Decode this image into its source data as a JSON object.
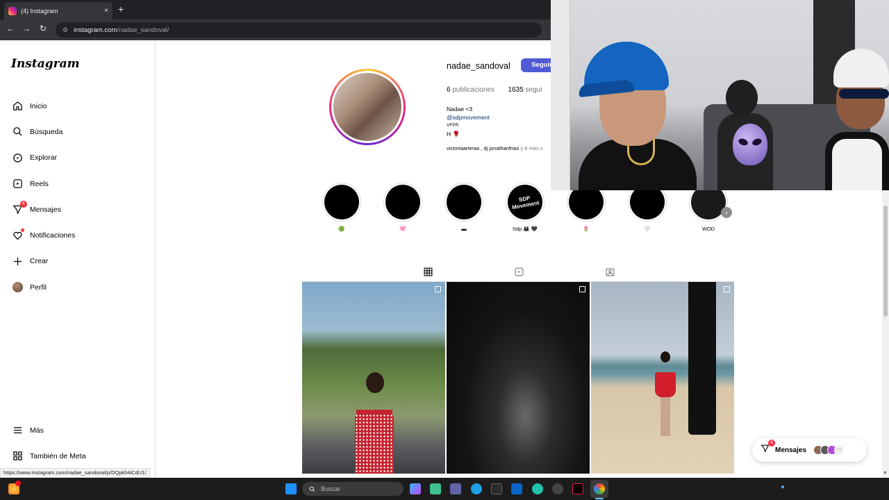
{
  "browser": {
    "tab_title": "(4) Instagram",
    "tab_close": "×",
    "new_tab": "+",
    "url_domain": "instagram.com",
    "url_path": "/nadae_sandoval/",
    "status_url": "https://www.instagram.com/nadae_sandoval/p/DQpkh4iCdU1/"
  },
  "sidebar": {
    "logo": "Instagram",
    "items": [
      {
        "label": "Inicio",
        "icon": "home-icon"
      },
      {
        "label": "Búsqueda",
        "icon": "search-icon"
      },
      {
        "label": "Explorar",
        "icon": "compass-icon"
      },
      {
        "label": "Reels",
        "icon": "reels-icon"
      },
      {
        "label": "Mensajes",
        "icon": "messenger-icon",
        "badge": "4"
      },
      {
        "label": "Notificaciones",
        "icon": "heart-icon"
      },
      {
        "label": "Crear",
        "icon": "plus-icon"
      },
      {
        "label": "Perfil",
        "icon": "avatar-icon"
      }
    ],
    "bottom": [
      {
        "label": "Más",
        "icon": "menu-icon"
      },
      {
        "label": "También de Meta",
        "icon": "grid-apps-icon"
      }
    ]
  },
  "profile": {
    "username": "nadae_sandoval",
    "follow_label": "Seguir",
    "posts_count": "6",
    "posts_label": "publicaciones",
    "followers_count": "1635",
    "followers_label": "segui",
    "bio_name": "Nadae <3",
    "bio_link": "@sdpmovement",
    "bio_line3": "VFPR",
    "bio_line4": "H 🌹",
    "followed_by": "victoriaarieraa , dj jonathanfrias",
    "followed_more": "y 8 más s"
  },
  "highlights": [
    {
      "label": "🟢",
      "text": ""
    },
    {
      "label": "🩷",
      "text": ""
    },
    {
      "label": "▬",
      "text": ""
    },
    {
      "label": "Sdp 👨‍👩‍👦 🖤",
      "text": "SDP Movement"
    },
    {
      "label": "🌷",
      "text": ""
    },
    {
      "label": "🤍",
      "text": ""
    },
    {
      "label": "WOD",
      "text": ""
    }
  ],
  "messages_pill": {
    "label": "Mensajes",
    "badge": "4",
    "more": "···"
  },
  "taskbar": {
    "search_placeholder": "Buscar",
    "notif_count": "1"
  },
  "colors": {
    "follow_button": "#4f5bd5",
    "badge": "#ff3040",
    "link": "#00376b"
  }
}
